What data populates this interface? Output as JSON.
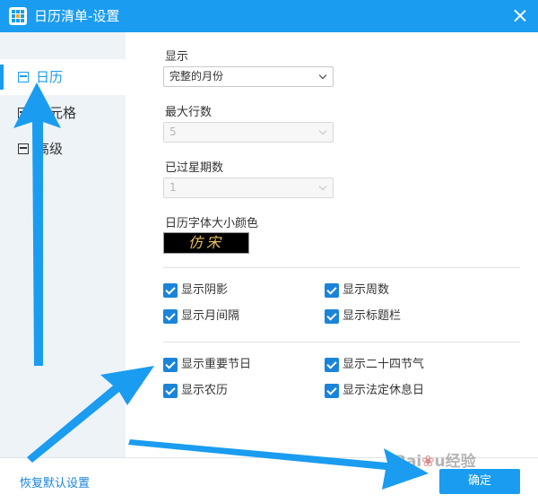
{
  "window": {
    "title": "日历清单-设置"
  },
  "sidebar": {
    "items": [
      {
        "label": "日历",
        "active": true
      },
      {
        "label": "单元格",
        "active": false
      },
      {
        "label": "高级",
        "active": false
      }
    ]
  },
  "settings": {
    "display": {
      "label": "显示",
      "value": "完整的月份"
    },
    "max_rows": {
      "label": "最大行数",
      "value": "5"
    },
    "past_weeks": {
      "label": "已过星期数",
      "value": "1"
    },
    "font": {
      "label": "日历字体大小颜色",
      "preview": "仿宋"
    },
    "checkboxes_group1": [
      {
        "label": "显示阴影",
        "checked": true
      },
      {
        "label": "显示周数",
        "checked": true
      },
      {
        "label": "显示月间隔",
        "checked": true
      },
      {
        "label": "显示标题栏",
        "checked": true
      }
    ],
    "checkboxes_group2": [
      {
        "label": "显示重要节日",
        "checked": true
      },
      {
        "label": "显示二十四节气",
        "checked": true
      },
      {
        "label": "显示农历",
        "checked": true
      },
      {
        "label": "显示法定休息日",
        "checked": true
      }
    ]
  },
  "footer": {
    "reset_label": "恢复默认设置",
    "ok_label": "确定"
  },
  "watermark": "Baidu经验",
  "colors": {
    "accent": "#1a9cf0",
    "arrow": "#1a9cf0"
  }
}
